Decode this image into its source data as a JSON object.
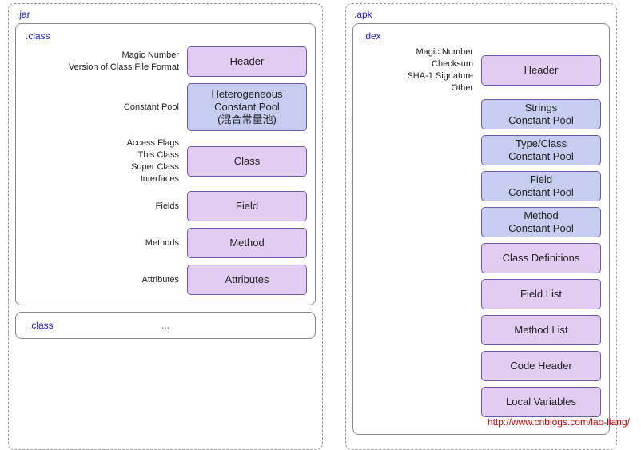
{
  "footer_url": "http://www.cnblogs.com/lao-liang/",
  "jar": {
    "title": ".jar",
    "class_box": {
      "title": ".class",
      "rows": [
        {
          "labels": [
            "Magic Number",
            "Version of Class File Format"
          ],
          "block": "Header",
          "color": "purple",
          "tall": false
        },
        {
          "labels": [
            "Constant Pool"
          ],
          "block_lines": [
            "Heterogeneous",
            "Constant Pool",
            "(混合常量池)"
          ],
          "color": "blue",
          "tall": true
        },
        {
          "labels": [
            "Access Flags",
            "This Class",
            "Super Class",
            "Interfaces"
          ],
          "block": "Class",
          "color": "purple",
          "tall": false
        },
        {
          "labels": [
            "Fields"
          ],
          "block": "Field",
          "color": "purple",
          "tall": false
        },
        {
          "labels": [
            "Methods"
          ],
          "block": "Method",
          "color": "purple",
          "tall": false
        },
        {
          "labels": [
            "Attributes"
          ],
          "block": "Attributes",
          "color": "purple",
          "tall": false
        }
      ]
    },
    "second_class_title": ".class",
    "ellipsis": "..."
  },
  "apk": {
    "title": ".apk",
    "dex_box": {
      "title": ".dex",
      "header_labels": [
        "Magic Number",
        "Checksum",
        "SHA-1 Signature",
        "Other"
      ],
      "rows": [
        {
          "block": "Header",
          "color": "purple",
          "has_labels": true
        },
        {
          "block_lines": [
            "Strings",
            "Constant Pool"
          ],
          "color": "blue"
        },
        {
          "block_lines": [
            "Type/Class",
            "Constant Pool"
          ],
          "color": "blue"
        },
        {
          "block_lines": [
            "Field",
            "Constant Pool"
          ],
          "color": "blue"
        },
        {
          "block_lines": [
            "Method",
            "Constant Pool"
          ],
          "color": "blue"
        },
        {
          "block": "Class Definitions",
          "color": "purple"
        },
        {
          "block": "Field List",
          "color": "purple"
        },
        {
          "block": "Method List",
          "color": "purple"
        },
        {
          "block": "Code Header",
          "color": "purple"
        },
        {
          "block": "Local Variables",
          "color": "purple"
        }
      ]
    }
  }
}
